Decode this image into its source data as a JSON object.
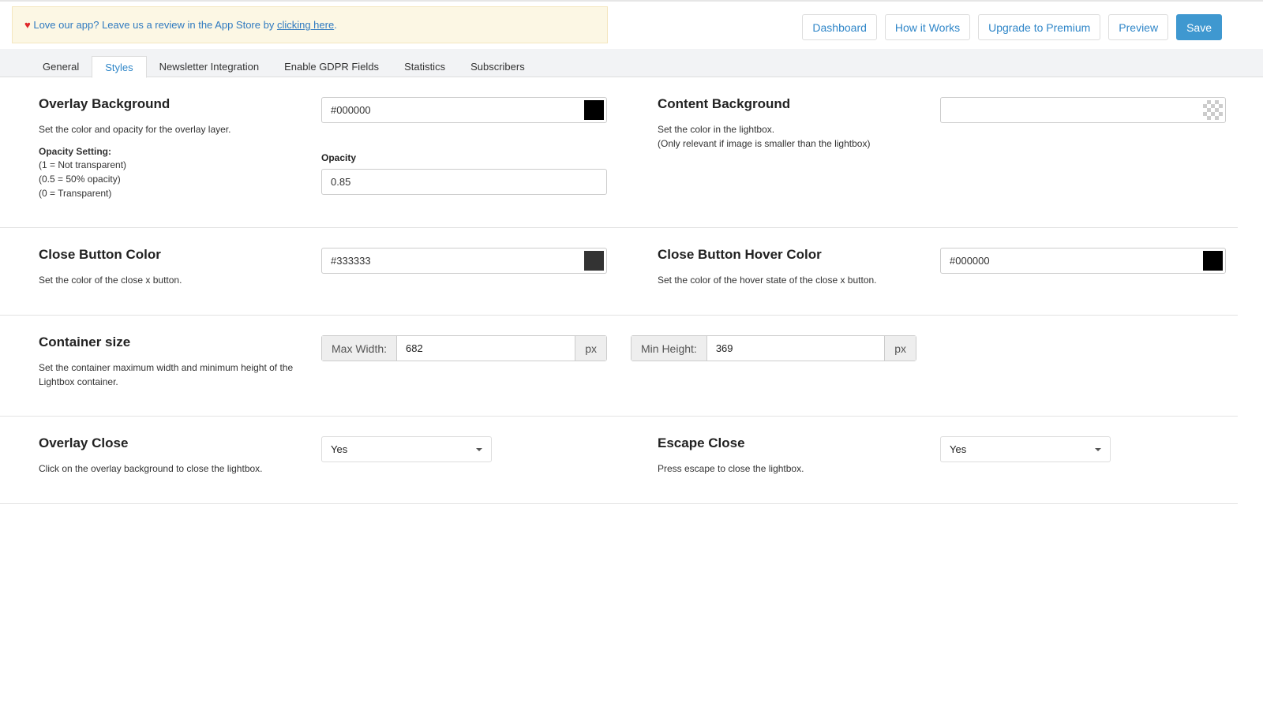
{
  "notice": {
    "text": "Love our app? Leave us a review in the App Store by ",
    "link": "clicking here",
    "end": "."
  },
  "header_buttons": {
    "dashboard": "Dashboard",
    "how": "How it Works",
    "upgrade": "Upgrade to Premium",
    "preview": "Preview",
    "save": "Save"
  },
  "tabs": [
    "General",
    "Styles",
    "Newsletter Integration",
    "Enable GDPR Fields",
    "Statistics",
    "Subscribers"
  ],
  "active_tab": "Styles",
  "overlay_bg": {
    "title": "Overlay Background",
    "desc": "Set the color and opacity for the overlay layer.",
    "opacity_heading": "Opacity Setting:",
    "notes": [
      "(1 = Not transparent)",
      "(0.5 = 50% opacity)",
      "(0 = Transparent)"
    ],
    "color": "#000000",
    "opacity_label": "Opacity",
    "opacity": "0.85"
  },
  "content_bg": {
    "title": "Content Background",
    "desc1": "Set the color in the lightbox.",
    "desc2": "(Only relevant if image is smaller than the lightbox)",
    "color": ""
  },
  "close_color": {
    "title": "Close Button Color",
    "desc": "Set the color of the close x button.",
    "color": "#333333"
  },
  "close_hover": {
    "title": "Close Button Hover Color",
    "desc": "Set the color of the hover state of the close x button.",
    "color": "#000000"
  },
  "container": {
    "title": "Container size",
    "desc": "Set the container maximum width and minimum height of the Lightbox container.",
    "max_width_label": "Max Width:",
    "max_width": "682",
    "min_height_label": "Min Height:",
    "min_height": "369",
    "unit": "px"
  },
  "overlay_close": {
    "title": "Overlay Close",
    "desc": "Click on the overlay background to close the lightbox.",
    "value": "Yes"
  },
  "escape_close": {
    "title": "Escape Close",
    "desc": "Press escape to close the lightbox.",
    "value": "Yes"
  }
}
